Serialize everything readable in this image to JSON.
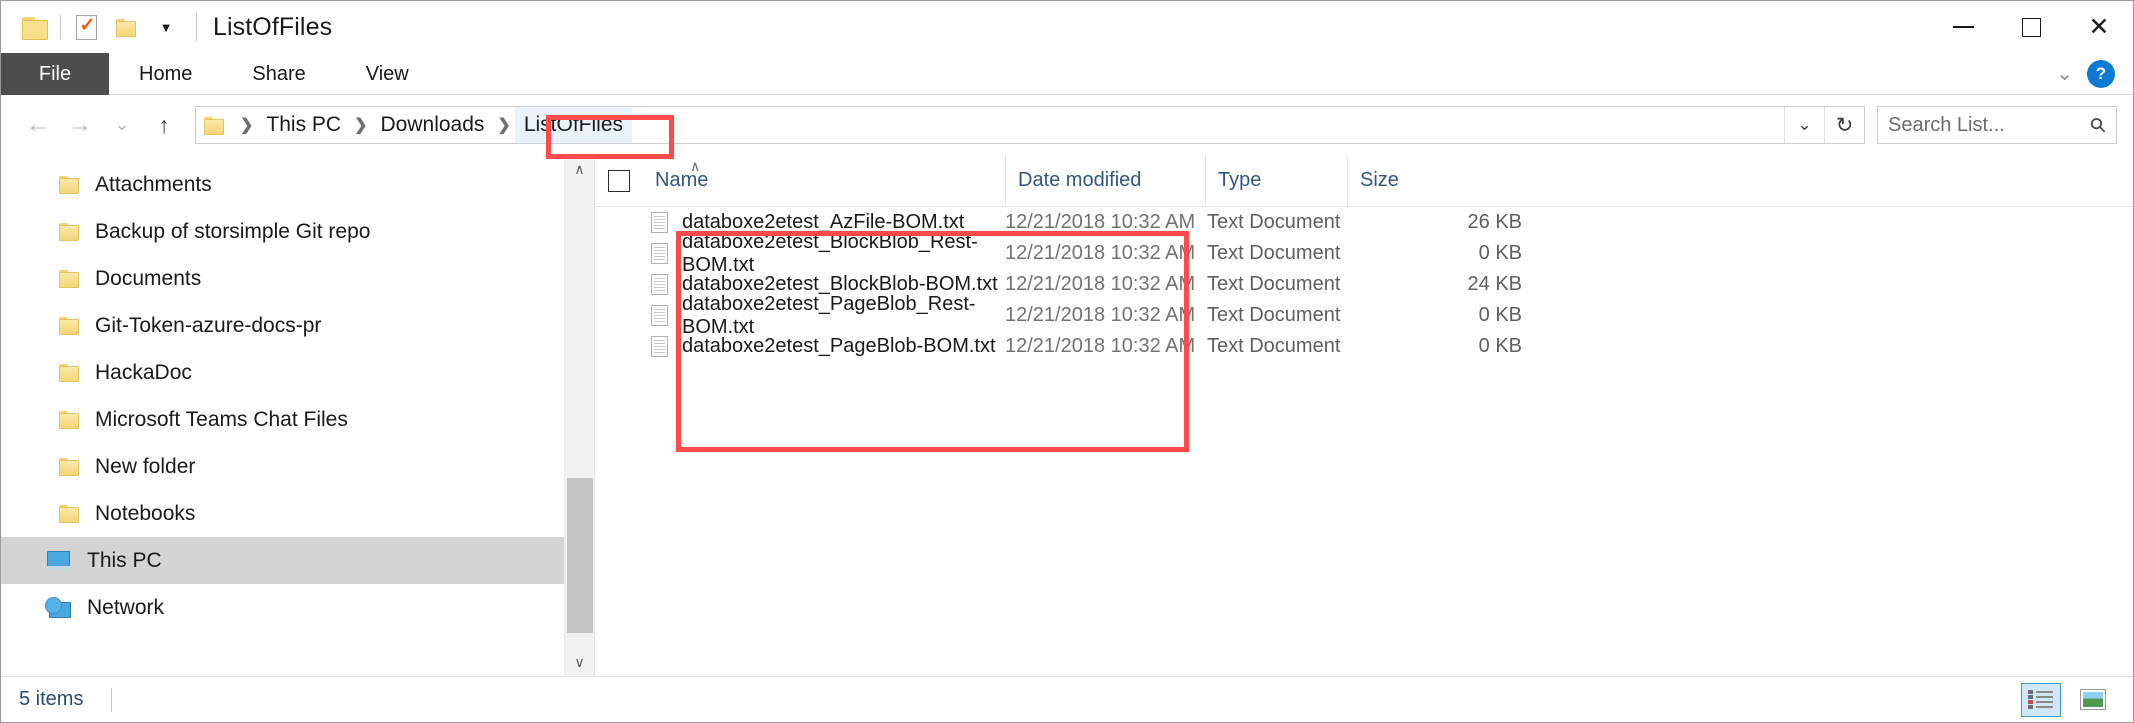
{
  "window": {
    "title": "ListOfFiles",
    "quick_access": [
      {
        "name": "folder-icon",
        "label": "Folder"
      },
      {
        "name": "properties-icon",
        "label": "Properties"
      },
      {
        "name": "new-folder-icon",
        "label": "New folder"
      },
      {
        "name": "customize-caret-icon",
        "label": "Customize Quick Access Toolbar"
      }
    ],
    "controls": {
      "minimize": "minimize-icon",
      "maximize": "maximize-icon",
      "close": "close-icon",
      "close_glyph": "✕"
    }
  },
  "ribbon": {
    "tabs": [
      {
        "label": "File",
        "active": true
      },
      {
        "label": "Home",
        "active": false
      },
      {
        "label": "Share",
        "active": false
      },
      {
        "label": "View",
        "active": false
      }
    ],
    "expand_glyph": "⌄",
    "help_glyph": "?"
  },
  "address_bar": {
    "back_glyph": "←",
    "forward_glyph": "→",
    "recent_glyph": "⌄",
    "up_glyph": "↑",
    "breadcrumbs": [
      {
        "label": "This PC",
        "highlighted": false
      },
      {
        "label": "Downloads",
        "highlighted": false
      },
      {
        "label": "ListOfFiles",
        "highlighted": true
      }
    ],
    "separator_glyph": "❯",
    "dropdown_glyph": "⌄",
    "refresh_glyph": "↻"
  },
  "search": {
    "placeholder": "Search List...",
    "icon_glyph": "⚲"
  },
  "sidebar": {
    "items": [
      {
        "label": "Attachments",
        "icon": "folder-icon",
        "selected": false
      },
      {
        "label": "Backup of storsimple Git repo",
        "icon": "folder-icon",
        "selected": false
      },
      {
        "label": "Documents",
        "icon": "folder-icon",
        "selected": false
      },
      {
        "label": "Git-Token-azure-docs-pr",
        "icon": "folder-icon",
        "selected": false
      },
      {
        "label": "HackaDoc",
        "icon": "folder-icon",
        "selected": false
      },
      {
        "label": "Microsoft Teams Chat Files",
        "icon": "folder-icon",
        "selected": false
      },
      {
        "label": "New folder",
        "icon": "folder-icon",
        "selected": false
      },
      {
        "label": "Notebooks",
        "icon": "folder-icon",
        "selected": false
      },
      {
        "label": "This PC",
        "icon": "this-pc-icon",
        "selected": true
      },
      {
        "label": "Network",
        "icon": "network-icon",
        "selected": false
      }
    ],
    "scroll_up_glyph": "∧",
    "scroll_down_glyph": "∨"
  },
  "file_list": {
    "columns": [
      {
        "label": "Name",
        "sorted": true,
        "sort_glyph": "∧"
      },
      {
        "label": "Date modified",
        "sorted": false
      },
      {
        "label": "Type",
        "sorted": false
      },
      {
        "label": "Size",
        "sorted": false
      }
    ],
    "rows": [
      {
        "name": "databoxe2etest_AzFile-BOM.txt",
        "date": "12/21/2018 10:32 AM",
        "type": "Text Document",
        "size": "26 KB"
      },
      {
        "name": "databoxe2etest_BlockBlob_Rest-BOM.txt",
        "date": "12/21/2018 10:32 AM",
        "type": "Text Document",
        "size": "0 KB"
      },
      {
        "name": "databoxe2etest_BlockBlob-BOM.txt",
        "date": "12/21/2018 10:32 AM",
        "type": "Text Document",
        "size": "24 KB"
      },
      {
        "name": "databoxe2etest_PageBlob_Rest-BOM.txt",
        "date": "12/21/2018 10:32 AM",
        "type": "Text Document",
        "size": "0 KB"
      },
      {
        "name": "databoxe2etest_PageBlob-BOM.txt",
        "date": "12/21/2018 10:32 AM",
        "type": "Text Document",
        "size": "0 KB"
      }
    ]
  },
  "status_bar": {
    "item_count": "5 items",
    "views": [
      {
        "name": "details-view",
        "active": true
      },
      {
        "name": "large-icons-view",
        "active": false
      }
    ]
  },
  "annotations": {
    "accent_color": "#fb4b4b",
    "boxes": [
      "breadcrumb-listoffiles",
      "file-name-column"
    ]
  }
}
